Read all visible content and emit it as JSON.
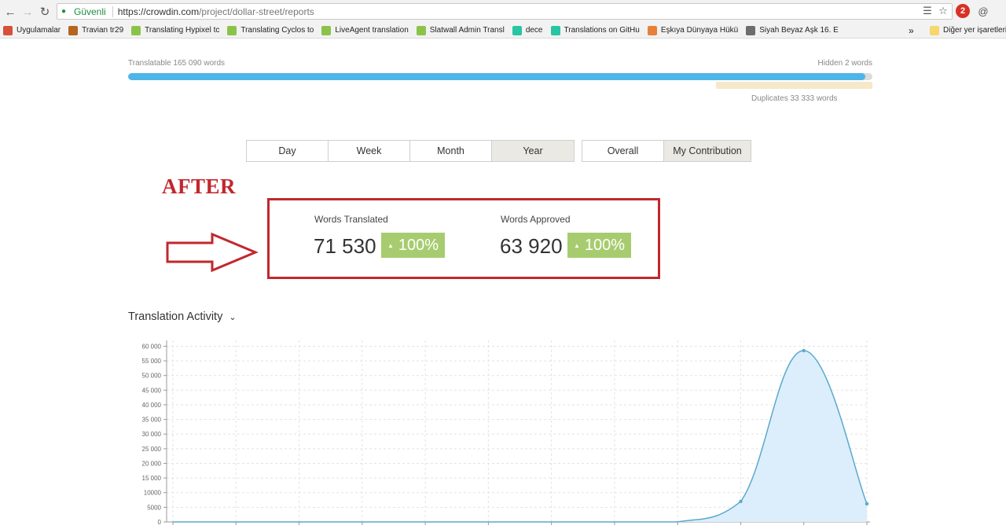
{
  "browser": {
    "secure_label": "Güvenli",
    "url_host": "https://crowdin.com",
    "url_path": "/project/dollar-street/reports",
    "extension_badge": "2",
    "bookmarks": [
      {
        "label": "Uygulamalar",
        "color": "#d64f3a"
      },
      {
        "label": "Travian tr29",
        "color": "#b5651d"
      },
      {
        "label": "Translating Hypixel tc",
        "color": "#8bc34a"
      },
      {
        "label": "Translating Cyclos to",
        "color": "#8bc34a"
      },
      {
        "label": "LiveAgent translation",
        "color": "#8bc34a"
      },
      {
        "label": "Slatwall Admin Transl",
        "color": "#8bc34a"
      },
      {
        "label": "dece",
        "color": "#26c6a2"
      },
      {
        "label": "Translations on GitHu",
        "color": "#26c6a2"
      },
      {
        "label": "Eşkıya Dünyaya Hükü",
        "color": "#e6813a"
      },
      {
        "label": "Siyah Beyaz Aşk 16. E",
        "color": "#6d6d6d"
      }
    ],
    "more_bookmarks": "»",
    "other_bookmarks": "Diğer yer işaretleri"
  },
  "summary": {
    "translatable": "Translatable 165 090 words",
    "hidden": "Hidden 2 words",
    "duplicates": "Duplicates 33 333 words",
    "translatable_fraction": 0.99
  },
  "period_tabs": [
    {
      "label": "Day",
      "active": false
    },
    {
      "label": "Week",
      "active": false
    },
    {
      "label": "Month",
      "active": false
    },
    {
      "label": "Year",
      "active": true
    }
  ],
  "scope_tabs": [
    {
      "label": "Overall",
      "active": false
    },
    {
      "label": "My Contribution",
      "active": true
    }
  ],
  "annotation": {
    "after_label": "AFTER",
    "highlight_color": "#c1272d"
  },
  "stats": {
    "translated": {
      "title": "Words Translated",
      "value": "71 530",
      "change": "100%"
    },
    "approved": {
      "title": "Words Approved",
      "value": "63 920",
      "change": "100%"
    }
  },
  "activity": {
    "title": "Translation Activity",
    "dropdown_icon": "chevron-down-icon"
  },
  "chart_data": {
    "type": "area",
    "title": "",
    "xlabel": "",
    "ylabel": "",
    "y_ticks": [
      "0",
      "5000",
      "10000",
      "15 000",
      "20 000",
      "25 000",
      "30 000",
      "35 000",
      "40 000",
      "45 000",
      "50 000",
      "55 000",
      "60 000"
    ],
    "ylim": [
      0,
      62000
    ],
    "x": [
      0,
      1,
      2,
      3,
      4,
      5,
      6,
      7,
      8,
      9,
      10,
      11
    ],
    "series": [
      {
        "values": [
          0,
          0,
          0,
          0,
          0,
          0,
          0,
          0,
          0,
          7000,
          58500,
          6200
        ]
      }
    ],
    "grid": true,
    "line_color": "#5aa9cc",
    "fill_color": "#dceefb"
  }
}
